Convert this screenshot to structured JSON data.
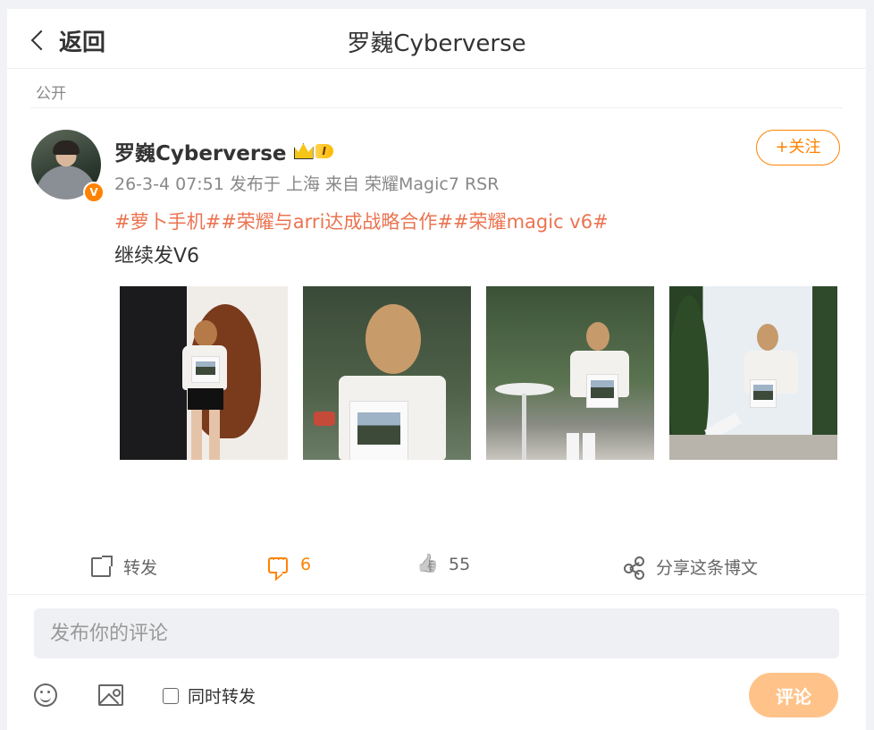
{
  "header": {
    "back_label": "返回",
    "title": "罗巍Cyberverse"
  },
  "post": {
    "visibility": "公开",
    "author": {
      "name": "罗巍Cyberverse",
      "verified_badge": "V",
      "member_level": "I"
    },
    "meta": "26-3-4 07:51 发布于 上海 来自 荣耀Magic7 RSR",
    "follow_label": "+关注",
    "topics": [
      "#萝卜手机#",
      "#荣耀与arri达成战略合作#",
      "#荣耀magic v6#"
    ],
    "text": "继续发V6",
    "photo_count": 4
  },
  "actions": {
    "repost_label": "转发",
    "comment_count": "6",
    "like_count": "55",
    "share_label": "分享这条博文"
  },
  "composer": {
    "placeholder": "发布你的评论",
    "repost_checkbox_label": "同时转发",
    "submit_label": "评论"
  },
  "colors": {
    "accent": "#ff8200",
    "topic": "#eb7350",
    "submit_disabled": "#ffc38a"
  }
}
